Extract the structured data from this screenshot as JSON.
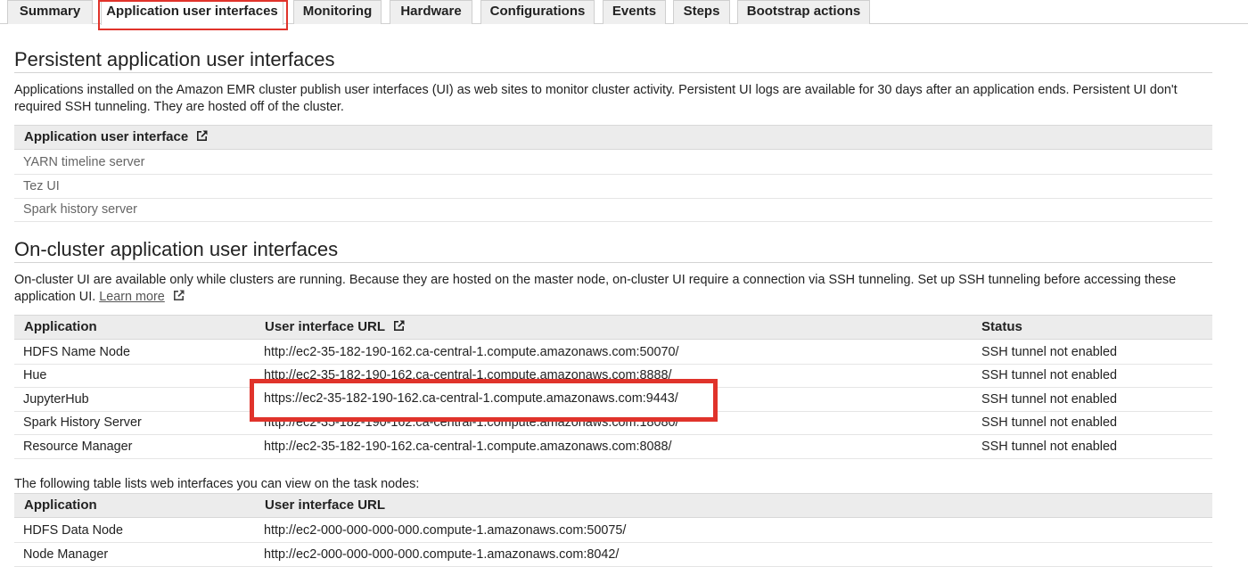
{
  "tabs": [
    {
      "label": "Summary",
      "active": false
    },
    {
      "label": "Application user interfaces",
      "active": true
    },
    {
      "label": "Monitoring",
      "active": false
    },
    {
      "label": "Hardware",
      "active": false
    },
    {
      "label": "Configurations",
      "active": false
    },
    {
      "label": "Events",
      "active": false
    },
    {
      "label": "Steps",
      "active": false
    },
    {
      "label": "Bootstrap actions",
      "active": false
    }
  ],
  "persistent": {
    "title": "Persistent application user interfaces",
    "description": "Applications installed on the Amazon EMR cluster publish user interfaces (UI) as web sites to monitor cluster activity. Persistent UI logs are available for 30 days after an application ends. Persistent UI don't required SSH tunneling. They are hosted off of the cluster.",
    "column_header": "Application user interface",
    "rows": [
      "YARN timeline server",
      "Tez UI",
      "Spark history server"
    ]
  },
  "on_cluster": {
    "title": "On-cluster application user interfaces",
    "description": "On-cluster UI are available only while clusters are running. Because they are hosted on the master node, on-cluster UI require a connection via SSH tunneling. Set up SSH tunneling before accessing these application UI.",
    "learn_more": "Learn more",
    "columns": [
      "Application",
      "User interface URL",
      "Status"
    ],
    "rows": [
      {
        "application": "HDFS Name Node",
        "url": "http://ec2-35-182-190-162.ca-central-1.compute.amazonaws.com:50070/",
        "status": "SSH tunnel not enabled"
      },
      {
        "application": "Hue",
        "url": "http://ec2-35-182-190-162.ca-central-1.compute.amazonaws.com:8888/",
        "status": "SSH tunnel not enabled"
      },
      {
        "application": "JupyterHub",
        "url": "https://ec2-35-182-190-162.ca-central-1.compute.amazonaws.com:9443/",
        "status": "SSH tunnel not enabled"
      },
      {
        "application": "Spark History Server",
        "url": "http://ec2-35-182-190-162.ca-central-1.compute.amazonaws.com:18080/",
        "status": "SSH tunnel not enabled"
      },
      {
        "application": "Resource Manager",
        "url": "http://ec2-35-182-190-162.ca-central-1.compute.amazonaws.com:8088/",
        "status": "SSH tunnel not enabled"
      }
    ]
  },
  "task_nodes": {
    "intro": "The following table lists web interfaces you can view on the task nodes:",
    "columns": [
      "Application",
      "User interface URL"
    ],
    "rows": [
      {
        "application": "HDFS Data Node",
        "url": "http://ec2-000-000-000-000.compute-1.amazonaws.com:50075/"
      },
      {
        "application": "Node Manager",
        "url": "http://ec2-000-000-000-000.compute-1.amazonaws.com:8042/"
      }
    ]
  },
  "colors": {
    "highlight": "#e0332b",
    "header_bg": "#ececec"
  }
}
